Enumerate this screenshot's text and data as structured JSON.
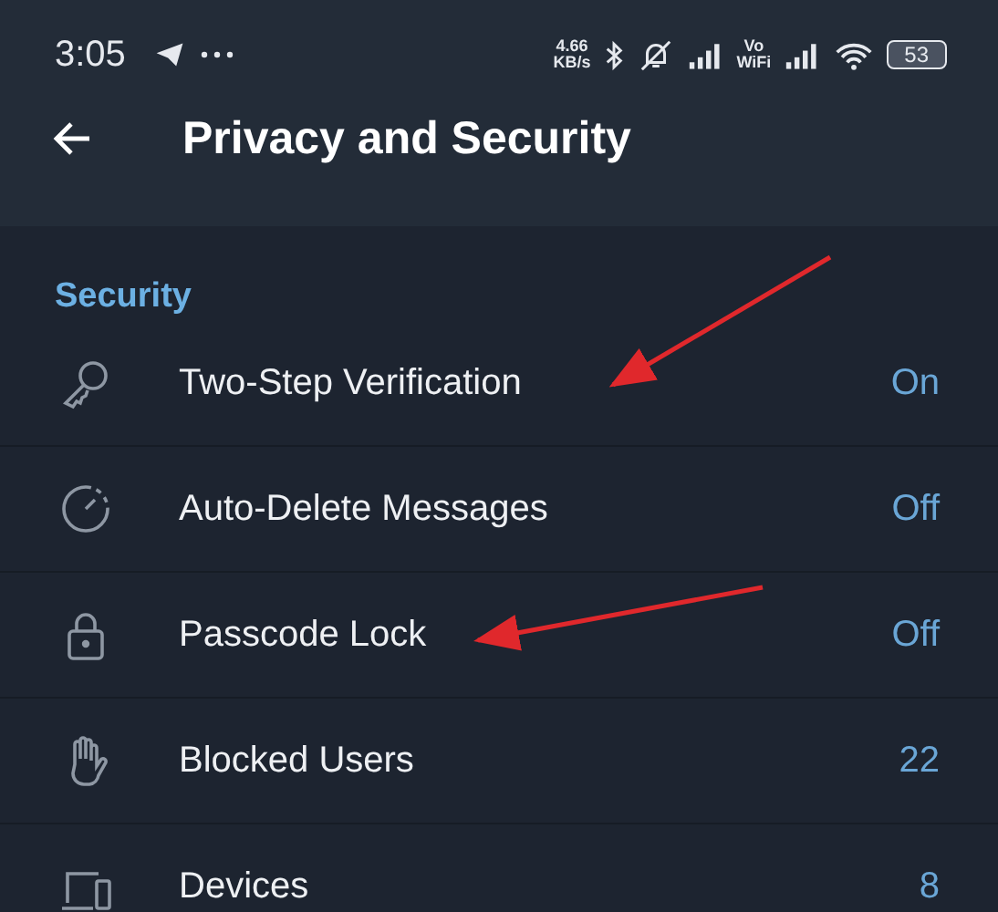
{
  "status_bar": {
    "time": "3:05",
    "speed": [
      "4.66",
      "KB/s"
    ],
    "vowifi": [
      "Vo",
      "WiFi"
    ],
    "battery": "53"
  },
  "header": {
    "title": "Privacy and Security"
  },
  "section": {
    "title": "Security"
  },
  "rows": [
    {
      "label": "Two-Step Verification",
      "value": "On"
    },
    {
      "label": "Auto-Delete Messages",
      "value": "Off"
    },
    {
      "label": "Passcode Lock",
      "value": "Off"
    },
    {
      "label": "Blocked Users",
      "value": "22"
    },
    {
      "label": "Devices",
      "value": "8"
    }
  ]
}
